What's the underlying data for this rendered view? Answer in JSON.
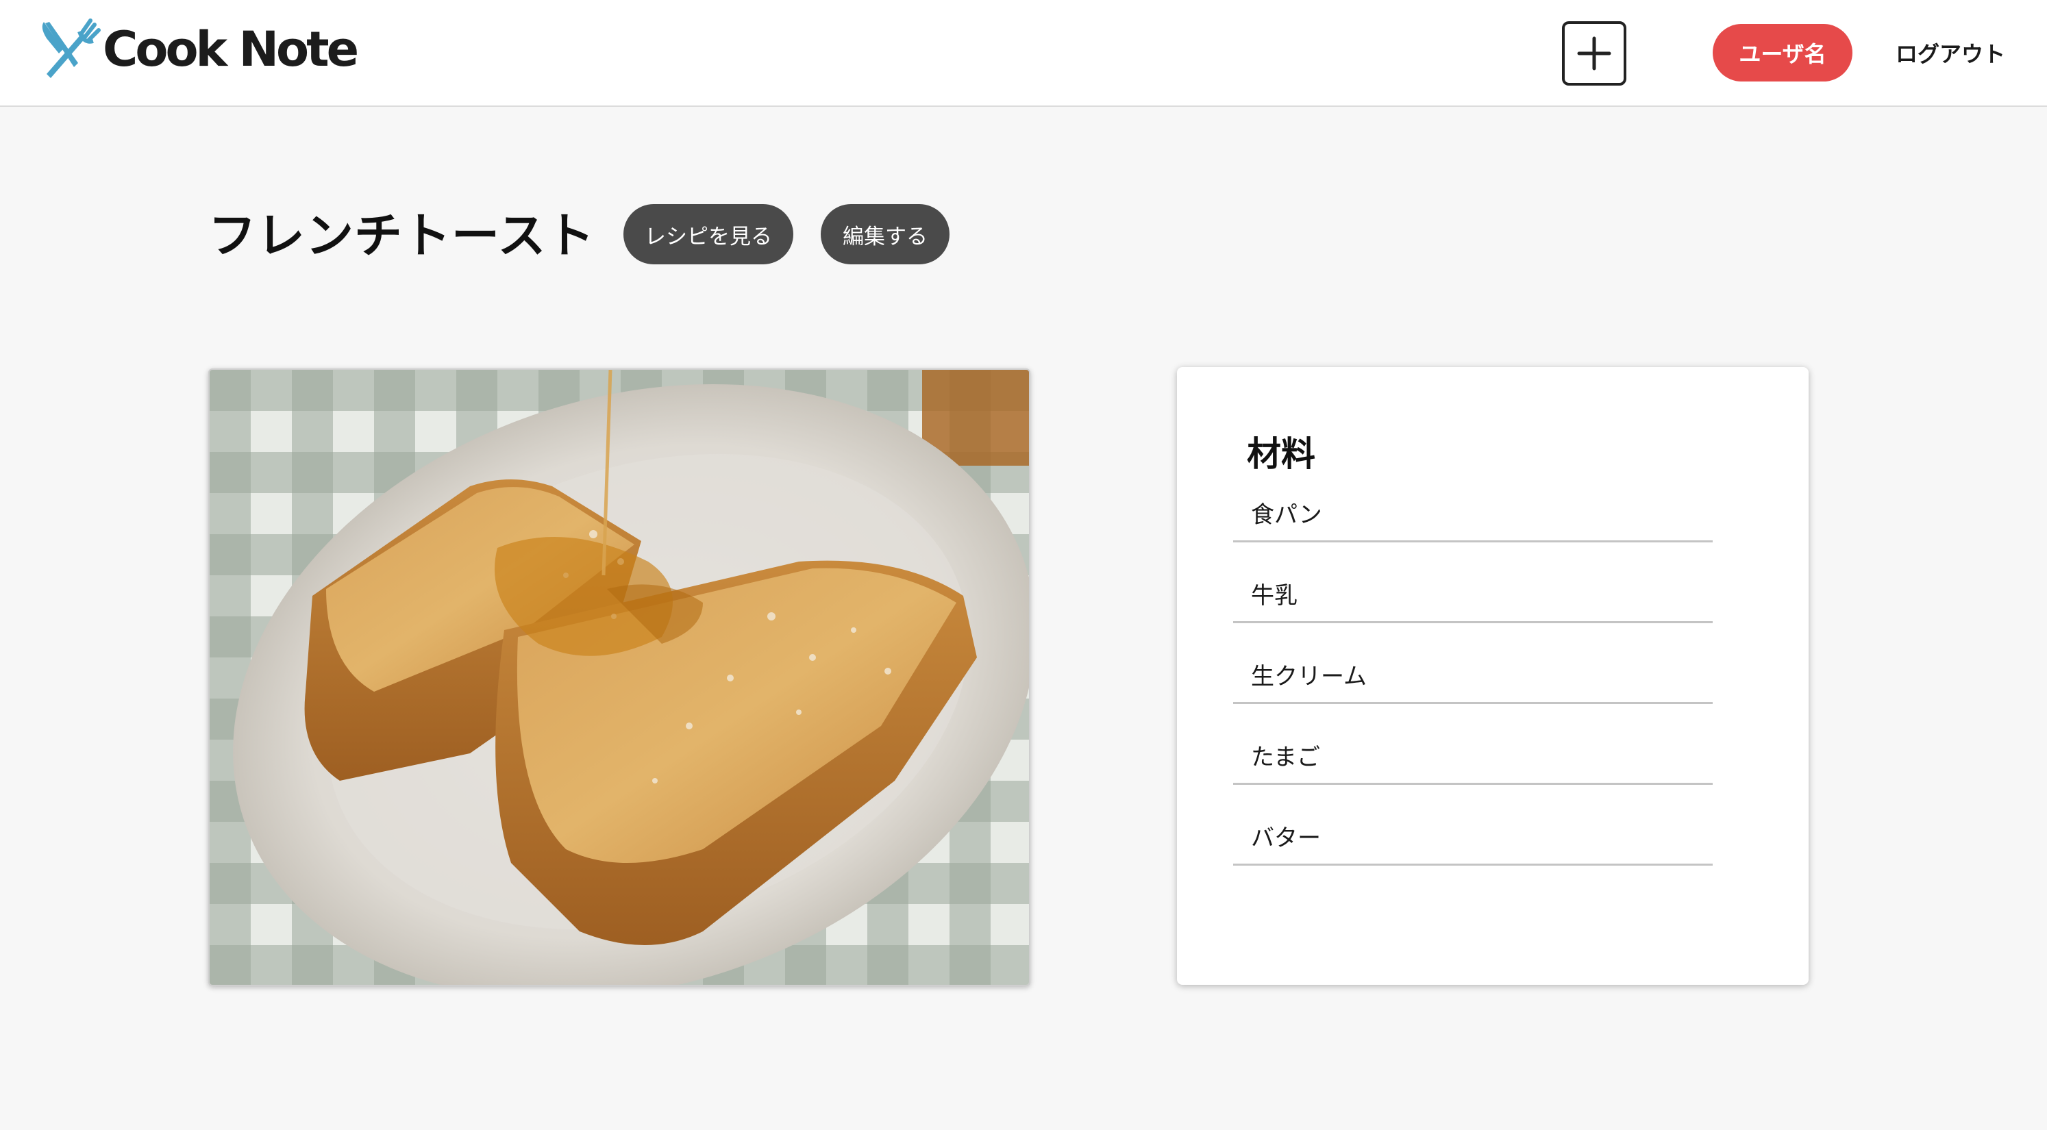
{
  "header": {
    "logo_text": "Cook Note",
    "logo_icon": "fork-and-knife-icon",
    "add_icon": "plus-icon",
    "user_label": "ユーザ名",
    "logout_label": "ログアウト",
    "colors": {
      "user_button": "#e64a4a",
      "logo_icon": "#4aa3c9"
    }
  },
  "recipe": {
    "title": "フレンチトースト",
    "view_recipe_label": "レシピを見る",
    "edit_label": "編集する",
    "photo_subject": "french-toast-photo"
  },
  "ingredients": {
    "title": "材料",
    "items": [
      "食パン",
      "牛乳",
      "生クリーム",
      "たまご",
      "バター"
    ]
  }
}
